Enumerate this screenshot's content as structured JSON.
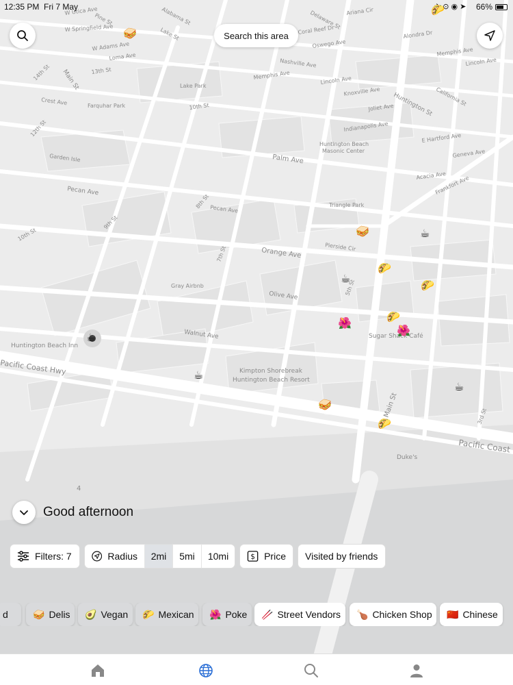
{
  "status": {
    "time": "12:35 PM",
    "date": "Fri 7 May",
    "battery": "66%"
  },
  "search_area_label": "Search this area",
  "streets": [
    "W Utica Ave",
    "Pine St",
    "W Adams Ave",
    "Loma Ave",
    "Main St",
    "14th St",
    "13th St",
    "Crest Ave",
    "Farquhar Park",
    "Lake Park",
    "10th St",
    "12th St",
    "Garden Isle",
    "Pecan Ave",
    "9th St",
    "10th St",
    "Huntington Beach Inn",
    "Pacific Coast Hwy",
    "Alabama St",
    "Lake St",
    "Nashville Ave",
    "Memphis Ave",
    "Delaware St",
    "Oswego Ave",
    "Coral Reef Dr",
    "Ariana Cir",
    "Lincoln Ave",
    "Knoxville Ave",
    "Joliet Ave",
    "Indianapolis Ave",
    "Huntington St",
    "California St",
    "E Hartford Ave",
    "Geneva Ave",
    "Acacia Ave",
    "Frankfort Ave",
    "Palm Ave",
    "Triangle Park",
    "Orange Ave",
    "Pierside Cir",
    "Olive Ave",
    "Walnut Ave",
    "Gray Airbnb",
    "Kimpton Shorebreak",
    "Huntington Beach Resort",
    "Sugar Shack Café",
    "Duke's",
    "Pacific Coast Hwy",
    "Main St",
    "5th St",
    "3rd St",
    "Huntington Beach",
    "Masonic Center",
    "8th St",
    "7th St",
    "Pecan Ave",
    "W Springfield Ave",
    "Alondra Dr",
    "Memphis Ave",
    "Lincoln Ave"
  ],
  "greeting": "Good afternoon",
  "filters": {
    "filters_label": "Filters: 7",
    "radius_label": "Radius",
    "radius_options": [
      "2mi",
      "5mi",
      "10mi"
    ],
    "radius_selected": "2mi",
    "price_label": "Price",
    "friends_label": "Visited by friends"
  },
  "categories": [
    {
      "label": "d",
      "emoji": "",
      "active": false
    },
    {
      "label": "Delis",
      "emoji": "🥪",
      "active": false
    },
    {
      "label": "Vegan",
      "emoji": "🥑",
      "active": false
    },
    {
      "label": "Mexican",
      "emoji": "🌮",
      "active": false
    },
    {
      "label": "Poke",
      "emoji": "🌺",
      "active": false
    },
    {
      "label": "Street Vendors",
      "emoji": "🥢",
      "active": true
    },
    {
      "label": "Chicken Shop",
      "emoji": "🍗",
      "active": true
    },
    {
      "label": "Chinese",
      "emoji": "🇨🇳",
      "active": true
    }
  ],
  "markers": [
    {
      "kind": "sandwich",
      "emoji": "🥪"
    },
    {
      "kind": "sandwich",
      "emoji": "🥪"
    },
    {
      "kind": "sandwich",
      "emoji": "🥪"
    },
    {
      "kind": "taco",
      "emoji": "🌮"
    },
    {
      "kind": "taco",
      "emoji": "🌮"
    },
    {
      "kind": "taco",
      "emoji": "🌮"
    },
    {
      "kind": "taco",
      "emoji": "🌮"
    },
    {
      "kind": "taco",
      "emoji": "🌮"
    },
    {
      "kind": "coffee",
      "emoji": "☕"
    },
    {
      "kind": "coffee",
      "emoji": "☕"
    },
    {
      "kind": "coffee",
      "emoji": "☕"
    },
    {
      "kind": "coffee",
      "emoji": "☕"
    },
    {
      "kind": "coffee",
      "emoji": "☕"
    },
    {
      "kind": "poke",
      "emoji": "🌺"
    },
    {
      "kind": "poke",
      "emoji": "🌺"
    }
  ],
  "map_misc_label": "4",
  "colors": {
    "map_bg": "#ececec",
    "road": "#ffffff",
    "water": "#dcdcdc",
    "accent": "#2b6fd6"
  },
  "tabs": [
    "home-icon",
    "globe-icon",
    "search-icon",
    "profile-icon"
  ]
}
